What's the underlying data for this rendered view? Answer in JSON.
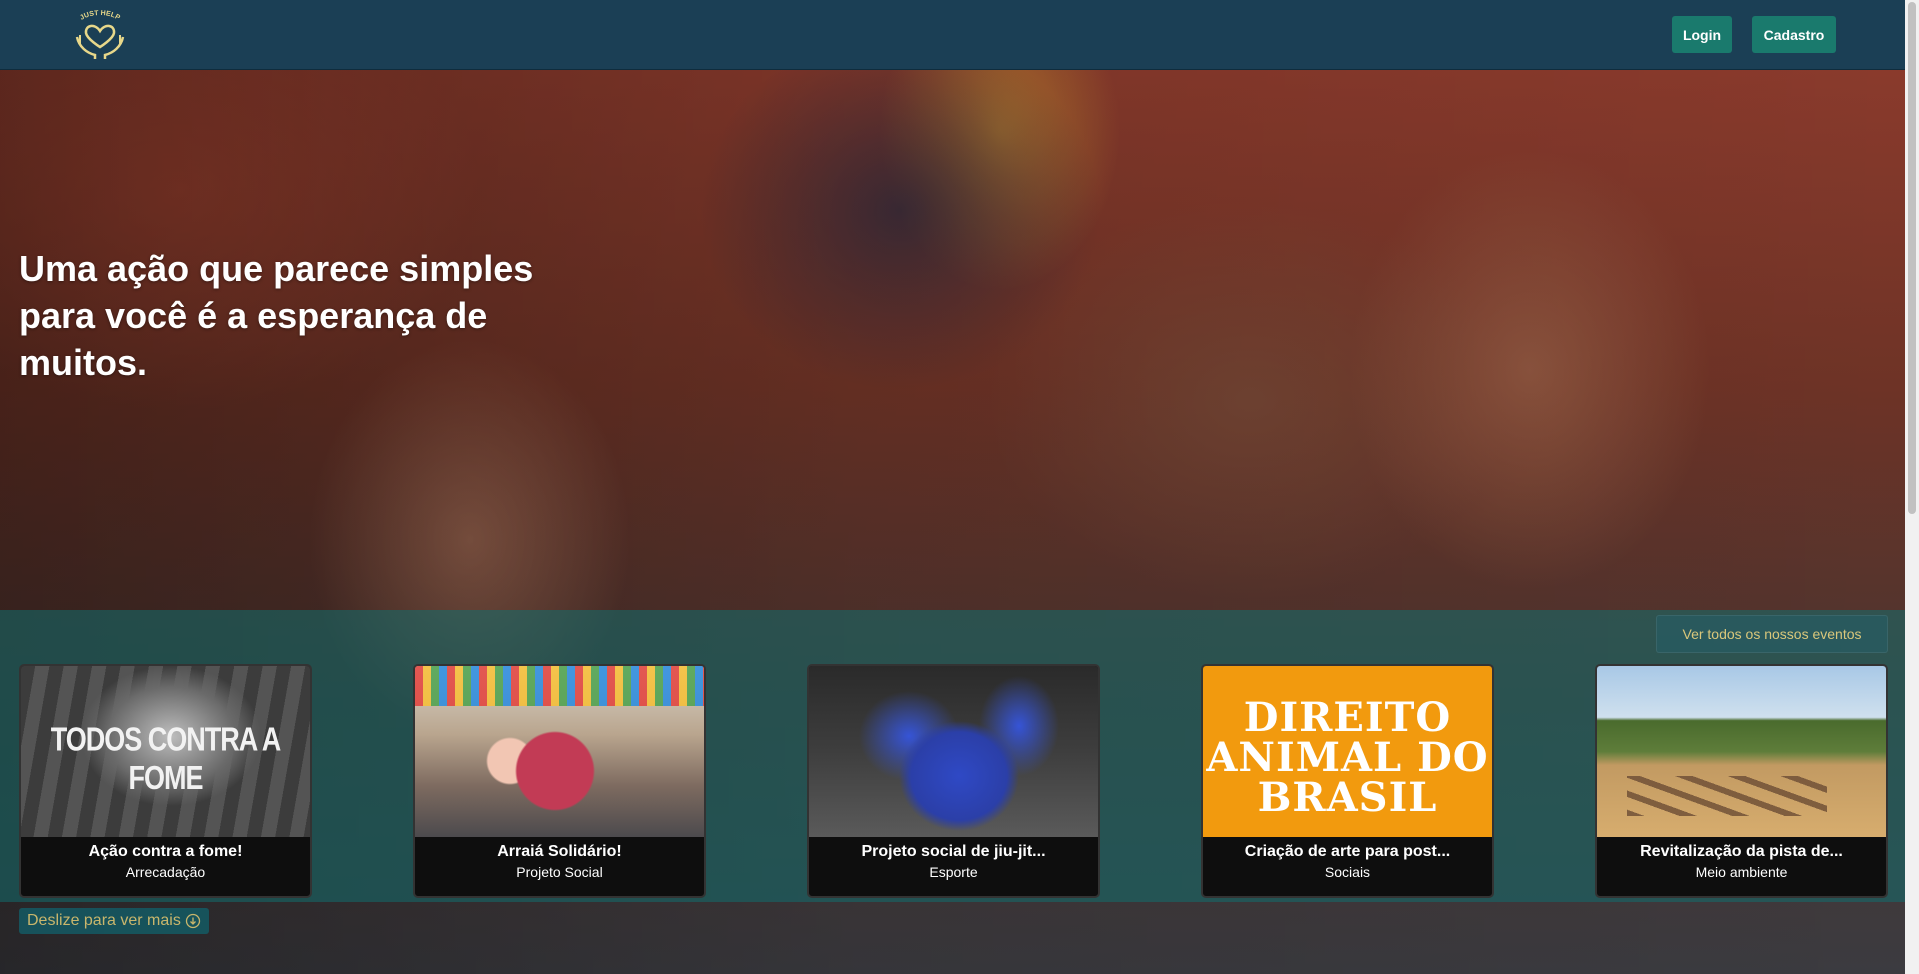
{
  "navbar": {
    "logo_text": "JUST HELP",
    "login_label": "Login",
    "signup_label": "Cadastro"
  },
  "hero": {
    "headline": "Uma ação que parece simples para você é a esperança de muitos."
  },
  "events": {
    "see_all_label": "Ver todos os nossos eventos",
    "cards": [
      {
        "title": "Ação contra a fome!",
        "category": "Arrecadação",
        "image_text": "TODOS CONTRA A FOME"
      },
      {
        "title": "Arraiá Solidário!",
        "category": "Projeto Social"
      },
      {
        "title": "Projeto social de jiu-jit...",
        "category": "Esporte"
      },
      {
        "title": "Criação de arte para post...",
        "category": "Sociais",
        "image_text": "DIREITO ANIMAL DO BRASIL"
      },
      {
        "title": "Revitalização da pista de...",
        "category": "Meio ambiente"
      }
    ]
  },
  "scroll_hint": {
    "label": "Deslize para ver mais"
  },
  "colors": {
    "navbar": "#1b3f55",
    "button": "#1a7a6d",
    "strip": "#126e6e",
    "gold": "#d9c77b"
  }
}
